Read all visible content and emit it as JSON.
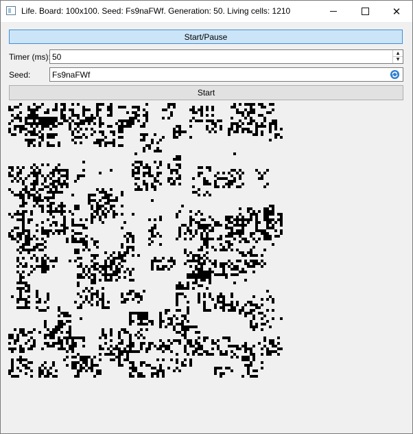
{
  "window": {
    "title": "Life. Board: 100x100. Seed: Fs9naFWf. Generation: 50. Living cells: 1210"
  },
  "controls": {
    "start_pause_label": "Start/Pause",
    "timer_label": "Timer (ms):",
    "timer_value": "50",
    "seed_label": "Seed:",
    "seed_value": "Fs9naFWf",
    "start_label": "Start"
  },
  "board": {
    "cols": 100,
    "rows": 100,
    "cell_color": "#000000",
    "background": "#f0f0f0",
    "generation": 50,
    "living_cells": 1210
  },
  "colors": {
    "accent_border": "#3c8fd8",
    "accent_fill": "#cce4f7"
  }
}
